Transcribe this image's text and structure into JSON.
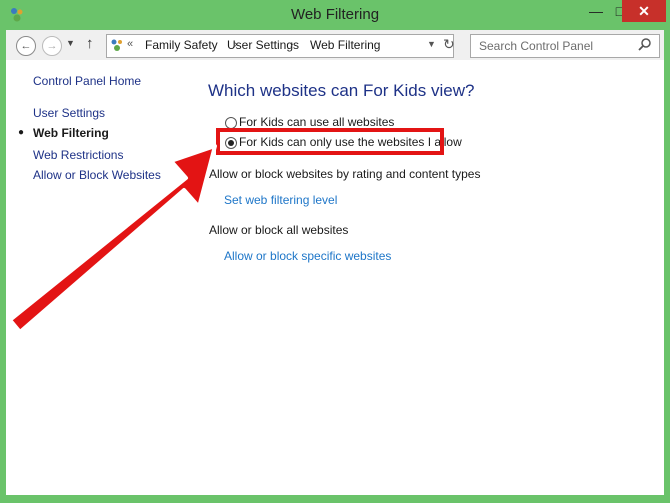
{
  "window": {
    "title": "Web Filtering",
    "minimize_glyph": "—",
    "maximize_glyph": "□",
    "close_glyph": "✕"
  },
  "navigation": {
    "back_glyph": "←",
    "forward_glyph": "→",
    "dropdown_glyph": "▼",
    "up_glyph": "↑",
    "overflow_glyph": "«",
    "breadcrumbs": [
      "Family Safety",
      "User Settings",
      "Web Filtering"
    ],
    "crumb_separator": "›",
    "refresh_glyph": "↻"
  },
  "search": {
    "placeholder": "Search Control Panel"
  },
  "sidebar": {
    "home_label": "Control Panel Home",
    "items": [
      {
        "label": "User Settings"
      },
      {
        "label": "Web Filtering",
        "current": true
      },
      {
        "label": "Web Restrictions"
      },
      {
        "label": "Allow or Block Websites"
      }
    ],
    "bullet_glyph": "●"
  },
  "main": {
    "heading": "Which websites can For Kids view?",
    "options": [
      {
        "label": "For Kids can use all websites",
        "selected": false
      },
      {
        "label": "For Kids can only use the websites I allow",
        "selected": true
      }
    ],
    "section1_label": "Allow or block websites by rating and content types",
    "section1_link": "Set web filtering level",
    "section2_label": "Allow or block all websites",
    "section2_link": "Allow or block specific websites"
  },
  "colors": {
    "titlebar": "#6ac36a",
    "close_button": "#c7302a",
    "highlight": "#e31414",
    "link": "#1e76c8",
    "heading": "#1e3287"
  },
  "icons": [
    "family-safety-icon",
    "control-panel-icon",
    "search-icon",
    "back-icon",
    "forward-icon",
    "up-arrow-icon",
    "refresh-icon"
  ]
}
